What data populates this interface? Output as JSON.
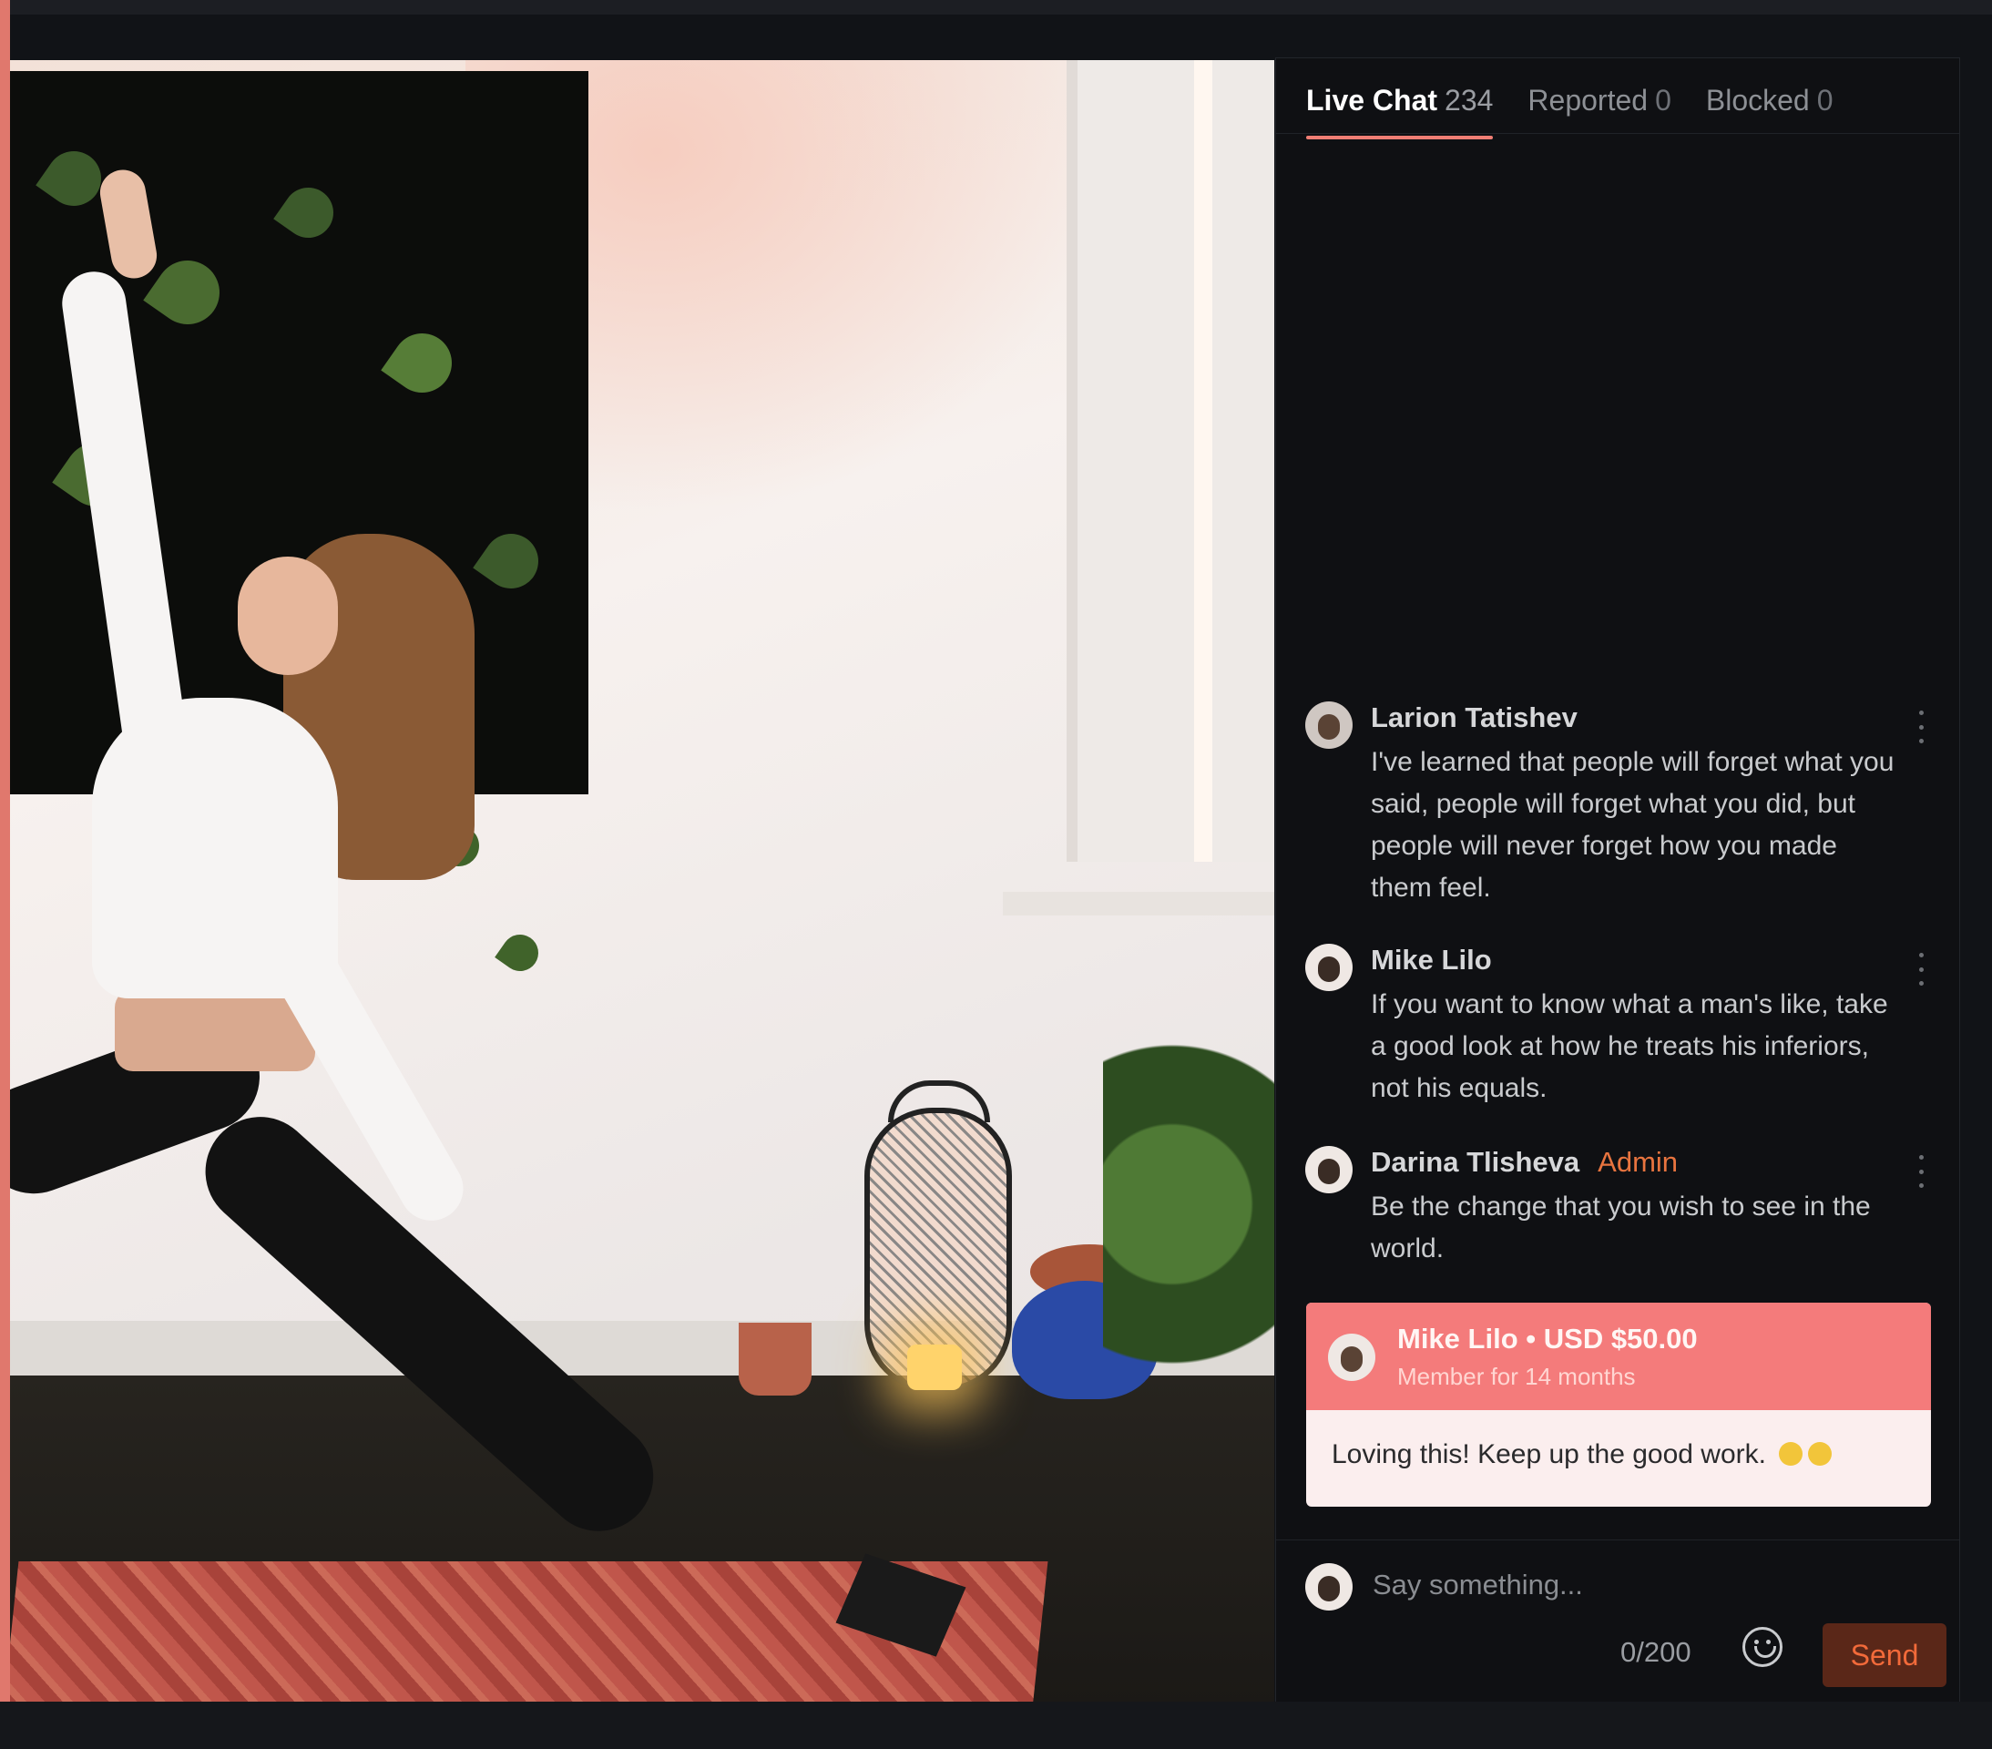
{
  "colors": {
    "accent": "#f07e74",
    "admin_badge": "#e8743f",
    "donation_header": "#f47b7b",
    "send_text": "#f26a3a"
  },
  "video": {
    "content": "yoga-stream-video-frame"
  },
  "tabs": [
    {
      "label": "Live Chat",
      "count": "234",
      "active": true
    },
    {
      "label": "Reported",
      "count": "0",
      "active": false
    },
    {
      "label": "Blocked",
      "count": "0",
      "active": false
    }
  ],
  "messages": [
    {
      "author": "Larion Tatishev",
      "badge": "",
      "text": "I've learned that people will forget what you said, people will forget what you did, but people will never forget how you made them feel."
    },
    {
      "author": "Mike Lilo",
      "badge": "",
      "text": "If you want to know what a man's like, take a good look at how he treats his inferiors, not his equals."
    },
    {
      "author": "Darina Tlisheva",
      "badge": "Admin",
      "text": "Be the change that you wish to see in the world."
    }
  ],
  "donation": {
    "donor": "Mike Lilo",
    "separator": "•",
    "amount": "USD $50.00",
    "member_since": "Member for 14 months",
    "message": "Loving this! Keep up the good work."
  },
  "composer": {
    "placeholder": "Say something...",
    "counter": "0/200",
    "send_label": "Send",
    "emoji_icon": "smiley-face-icon"
  }
}
